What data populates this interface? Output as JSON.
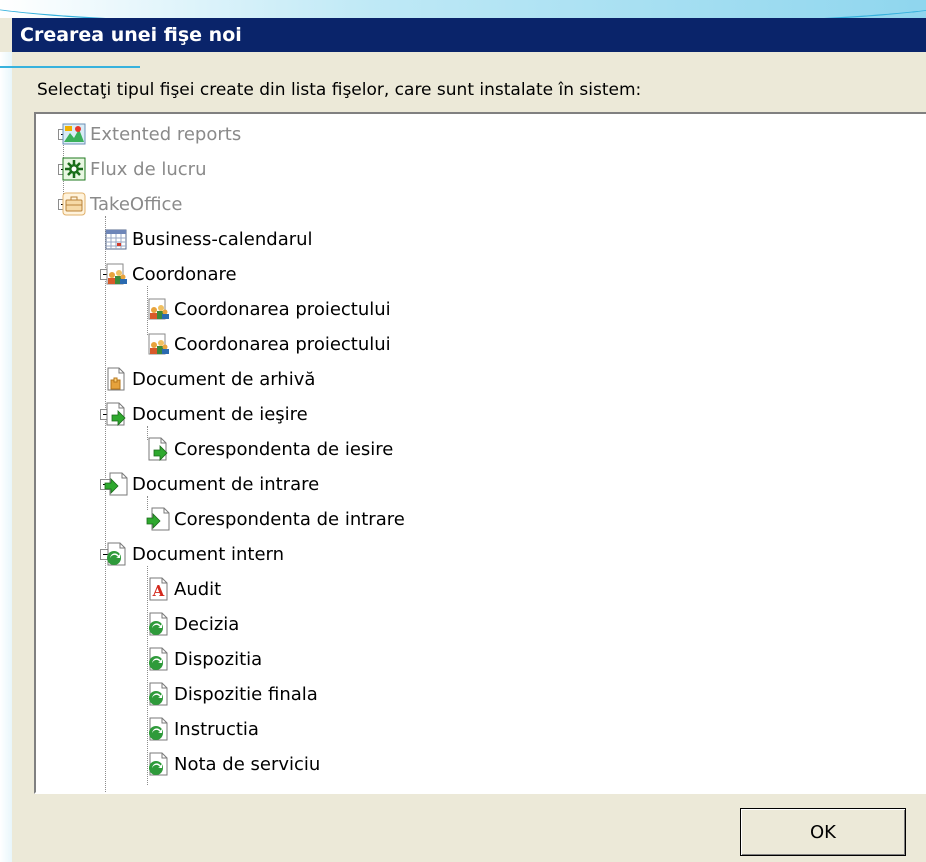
{
  "dialog": {
    "title": "Crearea unei fişe noi",
    "instruction": "Selectaţi tipul fişei create din lista fişelor, care sunt instalate în sistem:",
    "ok_label": "OK"
  },
  "tree": {
    "items": [
      {
        "label": "Extented reports",
        "level": 0,
        "toggle": "plus",
        "icon": "reports-icon",
        "grayed": true
      },
      {
        "label": "Flux de lucru",
        "level": 0,
        "toggle": "plus",
        "icon": "workflow-icon",
        "grayed": true
      },
      {
        "label": "TakeOffice",
        "level": 0,
        "toggle": "minus",
        "icon": "briefcase-icon",
        "grayed": true
      },
      {
        "label": "Business-calendarul",
        "level": 1,
        "toggle": null,
        "icon": "calendar-icon"
      },
      {
        "label": "Coordonare",
        "level": 1,
        "toggle": "minus",
        "icon": "people-icon"
      },
      {
        "label": "Coordonarea proiectului",
        "level": 2,
        "toggle": null,
        "icon": "people-icon"
      },
      {
        "label": "Coordonarea proiectului",
        "level": 2,
        "toggle": null,
        "icon": "people-icon"
      },
      {
        "label": "Document de arhivă",
        "level": 1,
        "toggle": null,
        "icon": "archive-document-icon"
      },
      {
        "label": "Document de ieşire",
        "level": 1,
        "toggle": "minus",
        "icon": "outgoing-document-icon"
      },
      {
        "label": "Corespondenta de iesire",
        "level": 2,
        "toggle": null,
        "icon": "outgoing-document-icon"
      },
      {
        "label": "Document de intrare",
        "level": 1,
        "toggle": "minus",
        "icon": "incoming-document-icon"
      },
      {
        "label": "Corespondenta de intrare",
        "level": 2,
        "toggle": null,
        "icon": "incoming-document-icon"
      },
      {
        "label": "Document intern",
        "level": 1,
        "toggle": "minus",
        "icon": "internal-document-icon"
      },
      {
        "label": "Audit",
        "level": 2,
        "toggle": null,
        "icon": "pdf-document-icon"
      },
      {
        "label": "Decizia",
        "level": 2,
        "toggle": null,
        "icon": "internal-document-icon"
      },
      {
        "label": "Dispozitia",
        "level": 2,
        "toggle": null,
        "icon": "internal-document-icon"
      },
      {
        "label": "Dispozitie finala",
        "level": 2,
        "toggle": null,
        "icon": "internal-document-icon"
      },
      {
        "label": "Instructia",
        "level": 2,
        "toggle": null,
        "icon": "internal-document-icon"
      },
      {
        "label": "Nota de serviciu",
        "level": 2,
        "toggle": null,
        "icon": "internal-document-icon"
      }
    ]
  }
}
